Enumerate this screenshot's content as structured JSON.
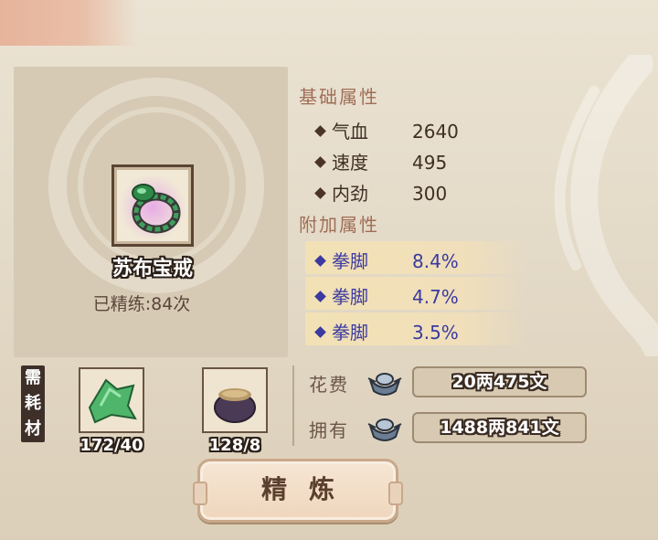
{
  "item": {
    "name": "苏布宝戒",
    "refine_count": "已精练:84次",
    "icon": "jade-ring-icon"
  },
  "base_attrs": {
    "title": "基础属性",
    "rows": [
      {
        "label": "气血",
        "value": "2640"
      },
      {
        "label": "速度",
        "value": "495"
      },
      {
        "label": "内劲",
        "value": "300"
      }
    ]
  },
  "extra_attrs": {
    "title": "附加属性",
    "rows": [
      {
        "label": "拳脚",
        "value": "8.4%"
      },
      {
        "label": "拳脚",
        "value": "4.7%"
      },
      {
        "label": "拳脚",
        "value": "3.5%"
      }
    ]
  },
  "materials": {
    "tag": "需耗材",
    "tag_chars": [
      "需",
      "耗",
      "材"
    ],
    "items": [
      {
        "icon": "green-cloth-icon",
        "count": "172/40"
      },
      {
        "icon": "sand-pot-icon",
        "count": "128/8"
      }
    ]
  },
  "money": {
    "cost_label": "花费",
    "cost_value": "20两475文",
    "own_label": "拥有",
    "own_value": "1488两841文",
    "icon": "silver-ingot-icon"
  },
  "action": {
    "refine_label": "精炼"
  },
  "colors": {
    "background": "#e4dac8",
    "section_title": "#a06e58",
    "extra_text": "#3a3aa0",
    "highlight": "#f3e1b6"
  }
}
